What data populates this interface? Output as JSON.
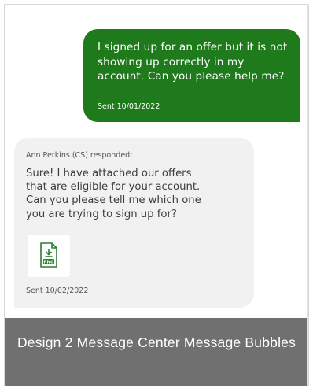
{
  "messages": {
    "sent": {
      "text": "I signed up for an offer but it is not\nshowing up correctly in my\naccount. Can you please help me?",
      "meta": "Sent 10/01/2022"
    },
    "received": {
      "from": "Ann Perkins (CS) responded:",
      "text": "Sure! I have attached our offers\nthat are eligible for your account.\nCan you please tell me which one\nyou are trying to sign up for?",
      "attachment": {
        "icon": "png-file-icon",
        "label": "PNG"
      },
      "meta": "Sent 10/02/2022"
    }
  },
  "caption": "Design 2 Message Center Message Bubbles",
  "colors": {
    "sent_bubble": "#1f7a1c",
    "received_bubble": "#f1f1f1",
    "caption_bg": "#484848"
  }
}
